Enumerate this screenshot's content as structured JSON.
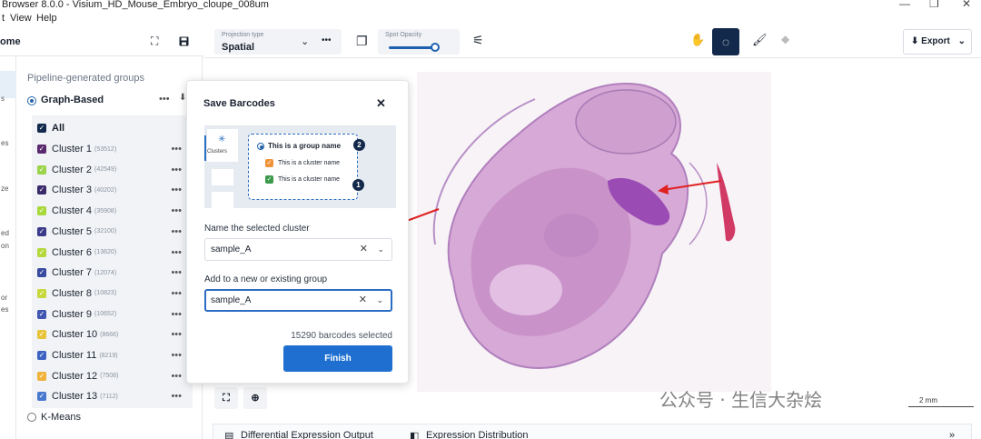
{
  "window": {
    "title": "Browser 8.0.0 - Visium_HD_Mouse_Embryo_cloupe_008um",
    "minimize": "—",
    "maximize": "❐",
    "close": "✕"
  },
  "menu": [
    "t",
    "View",
    "Help"
  ],
  "nav": {
    "home_label": "ome",
    "rail_labels": [
      "s",
      "es",
      "ze",
      "ed",
      "on",
      "or",
      "es"
    ]
  },
  "panel": {
    "heading": "Pipeline-generated groups",
    "graph_based": "Graph-Based",
    "kmeans": "K-Means",
    "all_label": "All",
    "clusters": [
      {
        "name": "Cluster 1",
        "count": "(53512)",
        "color": "#5a2a6e"
      },
      {
        "name": "Cluster 2",
        "count": "(42549)",
        "color": "#9bd44a"
      },
      {
        "name": "Cluster 3",
        "count": "(40202)",
        "color": "#3a2a6a"
      },
      {
        "name": "Cluster 4",
        "count": "(35908)",
        "color": "#a9d83a"
      },
      {
        "name": "Cluster 5",
        "count": "(32100)",
        "color": "#3b3a8a"
      },
      {
        "name": "Cluster 6",
        "count": "(13620)",
        "color": "#b5d93c"
      },
      {
        "name": "Cluster 7",
        "count": "(12074)",
        "color": "#3a4aa0"
      },
      {
        "name": "Cluster 8",
        "count": "(10823)",
        "color": "#c6d83a"
      },
      {
        "name": "Cluster 9",
        "count": "(10652)",
        "color": "#4156b0"
      },
      {
        "name": "Cluster 10",
        "count": "(8666)",
        "color": "#e8c43a"
      },
      {
        "name": "Cluster 11",
        "count": "(8219)",
        "color": "#3d63c2"
      },
      {
        "name": "Cluster 12",
        "count": "(7508)",
        "color": "#f0b23a"
      },
      {
        "name": "Cluster 13",
        "count": "(7112)",
        "color": "#4879d0"
      }
    ]
  },
  "toolbar": {
    "projection_label": "Projection type",
    "projection_value": "Spatial",
    "opacity_label": "Spot Opacity",
    "opacity_value": 0.85,
    "export_label": "Export"
  },
  "modal": {
    "title": "Save Barcodes",
    "illus_clusters": "Clusters",
    "illus_group": "This is a group name",
    "illus_cluster_1": "This is a cluster name",
    "illus_cluster_2": "This is a cluster name",
    "badge_1": "1",
    "badge_2": "2",
    "name_label": "Name the selected cluster",
    "name_value": "sample_A",
    "group_label": "Add to a new or existing group",
    "group_value": "sample_A",
    "selected_text": "15290 barcodes selected",
    "finish_label": "Finish"
  },
  "bottom": {
    "tab_de": "Differential Expression Output",
    "tab_ed": "Expression Distribution",
    "scale_label": "2 mm",
    "watermark": "公众号 · 生信大杂烩"
  },
  "colors": {
    "accent": "#1f6fd1",
    "dark": "#13294b",
    "arrow": "#e02020",
    "tissue": "#c38bc7"
  }
}
